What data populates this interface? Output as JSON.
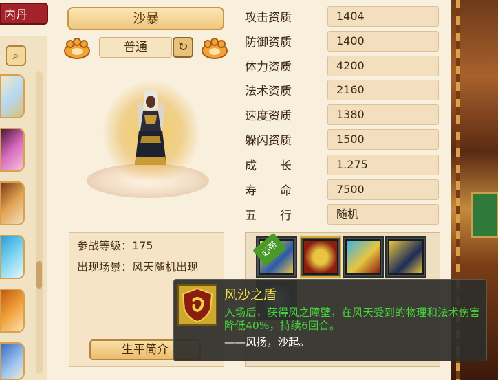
{
  "tab": {
    "label": "内丹"
  },
  "pet": {
    "name": "沙暴",
    "grade": "普通"
  },
  "attributes": [
    {
      "label": "攻击资质",
      "value": "1404"
    },
    {
      "label": "防御资质",
      "value": "1400"
    },
    {
      "label": "体力资质",
      "value": "4200"
    },
    {
      "label": "法术资质",
      "value": "2160"
    },
    {
      "label": "速度资质",
      "value": "1380"
    },
    {
      "label": "躲闪资质",
      "value": "1500"
    },
    {
      "label": "成　　长",
      "value": "1.275"
    },
    {
      "label": "寿　　命",
      "value": "7500"
    },
    {
      "label": "五　　行",
      "value": "随机"
    }
  ],
  "info": {
    "level_label": "参战等级：",
    "level_value": "175",
    "scene_label": "出现场景：",
    "scene_value": "风天随机出现",
    "bio_button": "生平简介"
  },
  "skills": {
    "must_tag": "必带",
    "icons": [
      "skill-bluewave-icon",
      "skill-shield-swirl-icon",
      "skill-shield-crystal-icon",
      "skill-crossed-swords-icon",
      "skill-blue-orb-icon"
    ]
  },
  "tooltip": {
    "title": "风沙之盾",
    "desc": "入场后，获得风之障壁，在风天受到的物理和法术伤害降低40%，持续6回合。",
    "quote": "——风扬，沙起。"
  },
  "colors": {
    "accent_red": "#a2242a",
    "tooltip_title": "#f6e24a",
    "tooltip_desc": "#46d43a"
  }
}
